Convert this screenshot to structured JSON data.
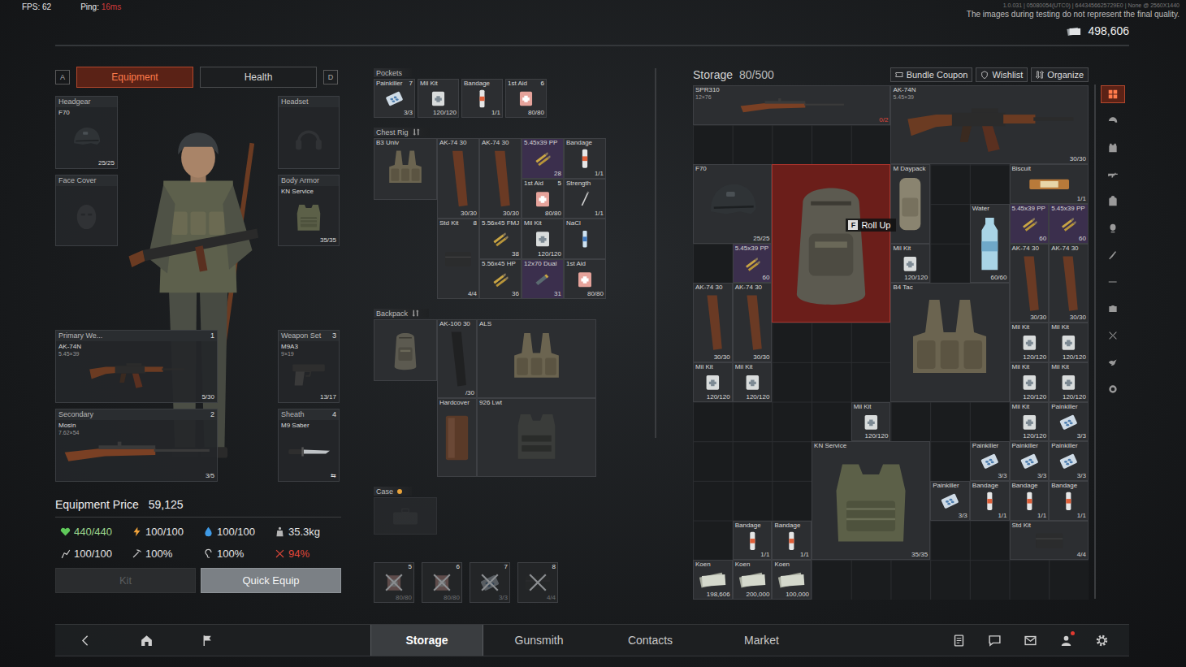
{
  "hud": {
    "fps": "FPS: 62",
    "ping_label": "Ping:",
    "ping": "16ms",
    "build": "1.0.031 | 05080054(UTC0) | 6443456625729E0 | None @ 2560X1440",
    "notice": "The images during testing do not represent the final quality.",
    "money": "498,606"
  },
  "equipment": {
    "tab_keys": [
      "A",
      "D"
    ],
    "tabs": [
      {
        "label": "Equipment",
        "selected": true
      },
      {
        "label": "Health",
        "selected": false
      }
    ],
    "headgear": {
      "label": "Headgear",
      "item": {
        "name": "F70",
        "value": "25/25",
        "kind": "helmet"
      }
    },
    "face_cover": {
      "label": "Face Cover",
      "item": null
    },
    "headset": {
      "label": "Headset",
      "item": null
    },
    "body_armor": {
      "label": "Body Armor",
      "item": {
        "name": "KN Service",
        "value": "35/35",
        "kind": "vest"
      }
    },
    "primary": {
      "label": "Primary We...",
      "key": "1",
      "item": {
        "name": "AK-74N",
        "sub": "5.45×39",
        "value": "5/30",
        "kind": "rifle"
      }
    },
    "weapon_set": {
      "label": "Weapon Set",
      "key": "3",
      "item": {
        "name": "M9A3",
        "sub": "9×19",
        "value": "13/17",
        "kind": "pistol"
      }
    },
    "secondary": {
      "label": "Secondary",
      "key": "2",
      "item": {
        "name": "Mosin",
        "sub": "7.62×54",
        "value": "3/5",
        "kind": "sniper"
      }
    },
    "sheath": {
      "label": "Sheath",
      "key": "4",
      "item": {
        "name": "M9 Saber",
        "value": "⇆",
        "kind": "knife"
      }
    },
    "price": {
      "label": "Equipment Price",
      "value": "59,125"
    },
    "stats": [
      {
        "value": "440/440",
        "kind": "health",
        "icon_color": "#5fc95a",
        "text_color": "#9ed88e"
      },
      {
        "value": "100/100",
        "kind": "energy",
        "icon_color": "#f0a23a",
        "text_color": "#e4e4e4"
      },
      {
        "value": "100/100",
        "kind": "hydration",
        "icon_color": "#3f9ae6",
        "text_color": "#e4e4e4"
      },
      {
        "value": "35.3kg",
        "kind": "weight",
        "icon_color": "#b5b5b5",
        "text_color": "#e4e4e4"
      },
      {
        "value": "100/100",
        "kind": "stamina",
        "icon_color": "#c8c8c8",
        "text_color": "#e4e4e4"
      },
      {
        "value": "100%",
        "kind": "durability",
        "icon_color": "#c8c8c8",
        "text_color": "#e4e4e4"
      },
      {
        "value": "100%",
        "kind": "hearing",
        "icon_color": "#c8c8c8",
        "text_color": "#e4e4e4"
      },
      {
        "value": "94%",
        "kind": "injury",
        "icon_color": "#e0473a",
        "text_color": "#e0473a"
      }
    ],
    "buttons": [
      {
        "label": "Kit",
        "disabled": true
      },
      {
        "label": "Quick Equip",
        "disabled": false
      }
    ]
  },
  "containers": {
    "pockets": {
      "title": "Pockets",
      "items": [
        {
          "name": "Painkiller",
          "key": "7",
          "value": "3/3",
          "kind": "pills"
        },
        {
          "name": "Mil Kit",
          "value": "120/120",
          "kind": "medkit"
        },
        {
          "name": "Bandage",
          "value": "1/1",
          "kind": "bandage"
        },
        {
          "name": "1st Aid",
          "key": "6",
          "value": "80/80",
          "kind": "firstaid"
        }
      ]
    },
    "chest_rig": {
      "title": "Chest Rig",
      "container": {
        "name": "B3 Univ",
        "kind": "rig"
      },
      "items": [
        {
          "name": "AK-74 30",
          "value": "30/30",
          "kind": "mag"
        },
        {
          "name": "AK-74 30",
          "value": "30/30",
          "kind": "mag"
        },
        {
          "name": "5.45x39 PP",
          "value": "28",
          "kind": "ammo",
          "color": "#3b2f4d"
        },
        {
          "name": "Bandage",
          "value": "1/1",
          "kind": "bandage"
        },
        {
          "name": "1st Aid",
          "key": "5",
          "value": "80/80",
          "kind": "firstaid"
        },
        {
          "name": "Strength",
          "value": "1/1",
          "kind": "stim"
        },
        {
          "name": "Std Kit",
          "key": "8",
          "value": "4/4",
          "kind": "kit"
        },
        {
          "name": "5.56x45 FMJ",
          "value": "38",
          "kind": "ammo"
        },
        {
          "name": "Mil Kit",
          "value": "120/120",
          "kind": "medkit"
        },
        {
          "name": "NaCl",
          "kind": "nacl"
        },
        {
          "name": "5.56x45 HP",
          "value": "36",
          "kind": "ammo"
        },
        {
          "name": "12x70 Dual",
          "value": "31",
          "kind": "shell",
          "color": "#3b2f4d"
        },
        {
          "name": "1st Aid",
          "value": "80/80",
          "kind": "firstaid"
        }
      ]
    },
    "backpack": {
      "title": "Backpack",
      "container": {
        "kind": "backpack"
      },
      "items": [
        {
          "name": "AK-100 30",
          "value": "/30",
          "kind": "polymag"
        },
        {
          "name": "ALS",
          "kind": "rig"
        },
        {
          "name": "Hardcover",
          "kind": "plate"
        },
        {
          "name": "926 Lwt",
          "kind": "carrier"
        }
      ]
    },
    "case": {
      "title": "Case",
      "kind": "case"
    },
    "quick_slots": [
      {
        "key": "5",
        "value": "80/80",
        "kind": "firstaid",
        "disabled": true
      },
      {
        "key": "6",
        "value": "80/80",
        "kind": "firstaid",
        "disabled": true
      },
      {
        "key": "7",
        "value": "3/3",
        "kind": "pills",
        "disabled": true
      },
      {
        "key": "8",
        "value": "4/4",
        "kind": "kit",
        "disabled": true
      }
    ]
  },
  "storage": {
    "title": "Storage",
    "capacity": "80/500",
    "actions": [
      "Bundle Coupon",
      "Wishlist",
      "Organize"
    ],
    "tooltip": {
      "key": "F",
      "label": "Roll Up"
    },
    "filters": [
      {
        "selected": true
      },
      {
        "selected": false
      },
      {
        "selected": false
      },
      {
        "selected": false
      },
      {
        "selected": false
      },
      {
        "selected": false
      },
      {
        "selected": false
      },
      {
        "selected": false
      },
      {
        "selected": false
      },
      {
        "selected": false
      },
      {
        "selected": false
      },
      {
        "selected": false
      }
    ],
    "items": [
      {
        "name": "SPR310",
        "sub": "12×76",
        "value": "0/2",
        "kind": "sniper",
        "warn": true,
        "selected": false
      },
      {
        "name": "AK-74N",
        "sub": "5.45×39",
        "value": "30/30",
        "kind": "rifle",
        "warn": false,
        "selected": false
      },
      {
        "name": "F70",
        "value": "25/25",
        "kind": "helmet",
        "warn": false,
        "selected": false
      },
      {
        "kind": "backpack",
        "warn": false,
        "selected": true
      },
      {
        "name": "M Daypack",
        "kind": "pouch",
        "warn": false,
        "selected": false
      },
      {
        "name": "Biscuit",
        "value": "1/1",
        "kind": "food",
        "warn": false,
        "selected": false
      },
      {
        "name": "Water",
        "value": "60/60",
        "kind": "water",
        "warn": false,
        "selected": false
      },
      {
        "name": "5.45x39 PP",
        "value": "60",
        "kind": "ammo",
        "color": "#3b2f4d",
        "warn": false,
        "selected": false
      },
      {
        "name": "5.45x39 PP",
        "value": "60",
        "kind": "ammo",
        "color": "#3b2f4d",
        "warn": false,
        "selected": false
      },
      {
        "name": "AK-74 30",
        "value": "30/30",
        "kind": "mag",
        "warn": false,
        "selected": false
      },
      {
        "name": "AK-74 30",
        "value": "30/30",
        "kind": "mag",
        "warn": false,
        "selected": false
      },
      {
        "name": "5.45x39 PP",
        "value": "60",
        "kind": "ammo",
        "color": "#3b2f4d",
        "warn": false,
        "selected": false
      },
      {
        "name": "Mil Kit",
        "value": "120/120",
        "kind": "medkit",
        "warn": false,
        "selected": false
      },
      {
        "name": "AK-74 30",
        "value": "30/30",
        "kind": "mag",
        "warn": false,
        "selected": false
      },
      {
        "name": "AK-74 30",
        "value": "30/30",
        "kind": "mag",
        "warn": false,
        "selected": false
      },
      {
        "name": "B4 Tac",
        "kind": "rig",
        "warn": false,
        "selected": false
      },
      {
        "name": "Mil Kit",
        "value": "120/120",
        "kind": "medkit",
        "warn": false,
        "selected": false
      },
      {
        "name": "Mil Kit",
        "value": "120/120",
        "kind": "medkit",
        "warn": false,
        "selected": false
      },
      {
        "name": "Mil Kit",
        "value": "120/120",
        "kind": "medkit",
        "warn": false,
        "selected": false
      },
      {
        "name": "Mil Kit",
        "value": "120/120",
        "kind": "medkit",
        "warn": false,
        "selected": false
      },
      {
        "name": "Mil Kit",
        "value": "120/120",
        "kind": "medkit",
        "warn": false,
        "selected": false
      },
      {
        "name": "Mil Kit",
        "value": "120/120",
        "kind": "medkit",
        "warn": false,
        "selected": false
      },
      {
        "name": "Mil Kit",
        "value": "120/120",
        "kind": "medkit",
        "warn": false,
        "selected": false
      },
      {
        "name": "Mil Kit",
        "value": "120/120",
        "kind": "medkit",
        "warn": false,
        "selected": false
      },
      {
        "name": "Painkiller",
        "value": "3/3",
        "kind": "pills",
        "warn": false,
        "selected": false
      },
      {
        "name": "KN Service",
        "value": "35/35",
        "kind": "vest",
        "warn": false,
        "selected": false
      },
      {
        "name": "Painkiller",
        "value": "3/3",
        "kind": "pills",
        "warn": false,
        "selected": false
      },
      {
        "name": "Painkiller",
        "value": "3/3",
        "kind": "pills",
        "warn": false,
        "selected": false
      },
      {
        "name": "Painkiller",
        "value": "3/3",
        "kind": "pills",
        "warn": false,
        "selected": false
      },
      {
        "name": "Painkiller",
        "value": "3/3",
        "kind": "pills",
        "warn": false,
        "selected": false
      },
      {
        "name": "Bandage",
        "value": "1/1",
        "kind": "bandage",
        "warn": false,
        "selected": false
      },
      {
        "name": "Bandage",
        "value": "1/1",
        "kind": "bandage",
        "warn": false,
        "selected": false
      },
      {
        "name": "Bandage",
        "value": "1/1",
        "kind": "bandage",
        "warn": false,
        "selected": false
      },
      {
        "name": "Bandage",
        "value": "1/1",
        "kind": "bandage",
        "warn": false,
        "selected": false
      },
      {
        "name": "Bandage",
        "value": "1/1",
        "kind": "bandage",
        "warn": false,
        "selected": false
      },
      {
        "name": "Std Kit",
        "value": "4/4",
        "kind": "kit",
        "warn": false,
        "selected": false
      },
      {
        "name": "Koen",
        "value": "198,606",
        "kind": "money",
        "warn": false,
        "selected": false
      },
      {
        "name": "Koen",
        "value": "200,000",
        "kind": "money",
        "warn": false,
        "selected": false
      },
      {
        "name": "Koen",
        "value": "100,000",
        "kind": "money",
        "warn": false,
        "selected": false
      }
    ]
  },
  "nav": {
    "tabs": [
      {
        "label": "Storage",
        "selected": true
      },
      {
        "label": "Gunsmith",
        "selected": false
      },
      {
        "label": "Contacts",
        "selected": false
      },
      {
        "label": "Market",
        "selected": false
      }
    ],
    "profile_alert": true
  }
}
